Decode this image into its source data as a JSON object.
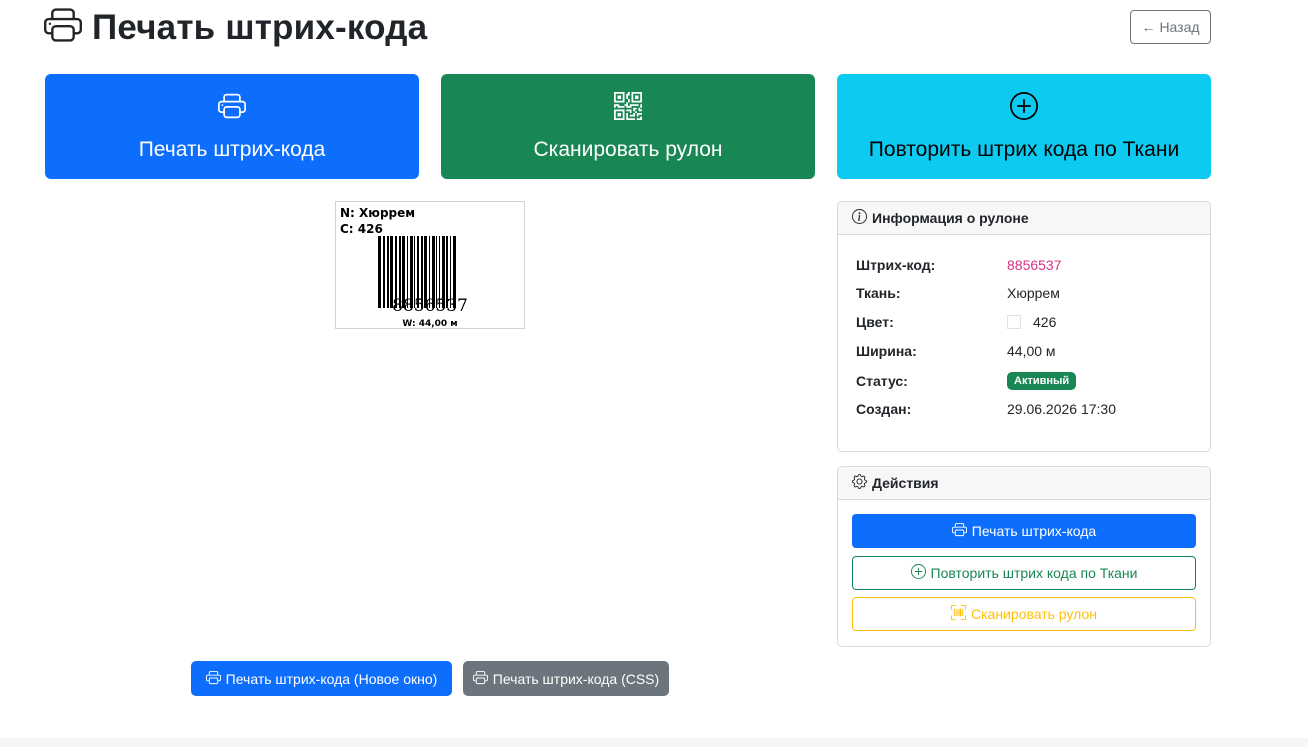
{
  "page": {
    "title": "Печать штрих-кода",
    "title_icon": "printer-icon"
  },
  "back_button": {
    "label": "Назад",
    "icon": "arrow-left-icon"
  },
  "big_buttons": {
    "print": {
      "label": "Печать штрих-кода",
      "icon": "printer-icon",
      "color": "#0d6efd"
    },
    "scan": {
      "label": "Сканировать рулон",
      "icon": "qr-code-icon",
      "color": "#198754"
    },
    "repeat": {
      "label": "Повторить штрих кода по Ткани",
      "icon": "plus-circle-icon",
      "color": "#0dcaf0"
    }
  },
  "label_preview": {
    "name_prefix": "N:",
    "name": "Хюррем",
    "color_prefix": "C:",
    "color": "426",
    "barcode": "8856537",
    "width_text": "W: 44,00 м"
  },
  "info_card": {
    "title": "Информация о рулоне",
    "icon": "info-circle-icon",
    "rows": [
      {
        "key": "Штрих-код:",
        "value": "8856537"
      },
      {
        "key": "Ткань:",
        "value": "Хюррем"
      },
      {
        "key": "Цвет:",
        "value": "426"
      },
      {
        "key": "Ширина:",
        "value": "44,00 м"
      },
      {
        "key": "Статус:",
        "value": "Активный"
      },
      {
        "key": "Создан:",
        "value": "29.06.2026 17:30"
      }
    ],
    "status_color": "#198754"
  },
  "actions_card": {
    "title": "Действия",
    "icon": "gear-icon",
    "print_label": "Печать штрих-кода",
    "repeat_label": "Повторить штрих кода по Ткани",
    "scan_label": "Сканировать рулон"
  },
  "bottom_buttons": {
    "new_window_label": "Печать штрих-кода (Новое окно)",
    "css_label": "Печать штрих-кода (CSS)"
  }
}
